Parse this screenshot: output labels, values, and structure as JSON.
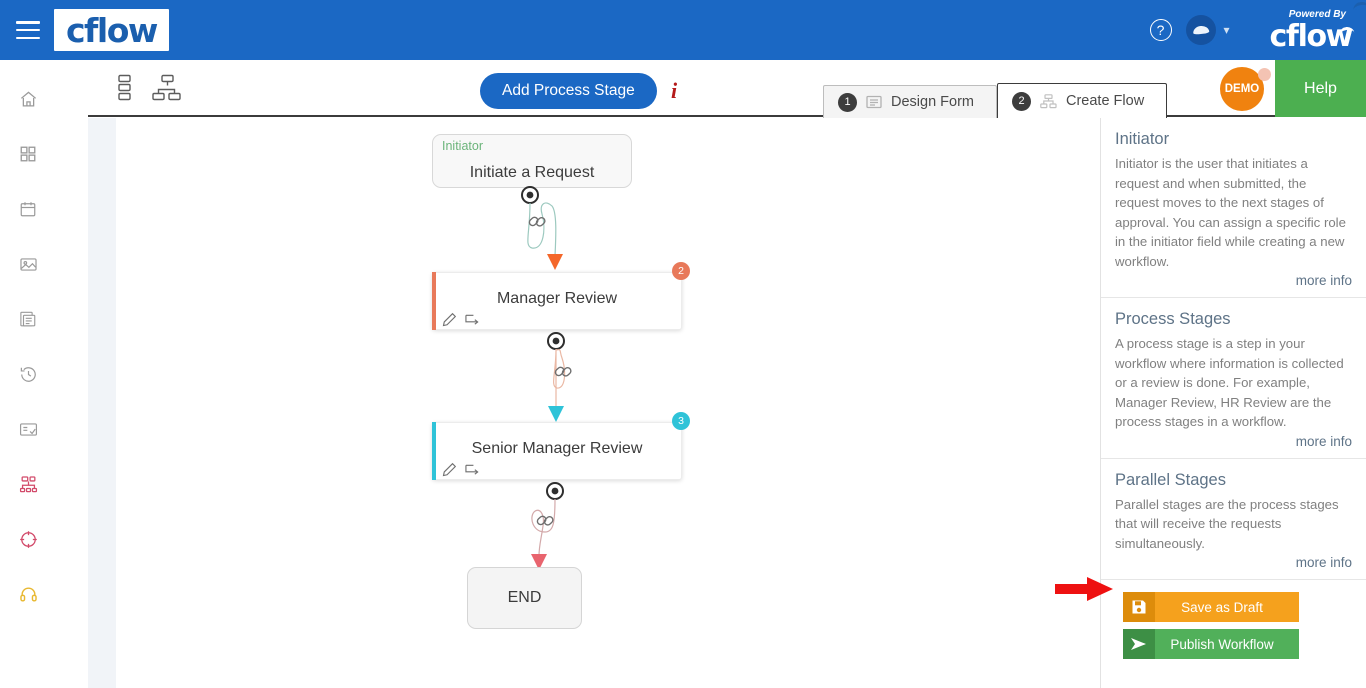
{
  "topbar": {
    "menu_icon": "hamburger-icon",
    "logo_text": "cflow",
    "help_icon": "question-circle-icon",
    "avatar_icon": "user-avatar-icon",
    "dropdown_icon": "chevron-down-icon",
    "powered_by": "Powered By",
    "powered_logo_text": "cflow"
  },
  "sidebar": {
    "items": [
      {
        "icon": "home-icon",
        "name": "sidebar-item-home"
      },
      {
        "icon": "apps-grid-icon",
        "name": "sidebar-item-apps"
      },
      {
        "icon": "calendar-icon",
        "name": "sidebar-item-calendar"
      },
      {
        "icon": "image-icon",
        "name": "sidebar-item-media"
      },
      {
        "icon": "document-icon",
        "name": "sidebar-item-documents"
      },
      {
        "icon": "history-clock-icon",
        "name": "sidebar-item-history"
      },
      {
        "icon": "report-card-icon",
        "name": "sidebar-item-reports"
      },
      {
        "icon": "org-chart-icon",
        "name": "sidebar-item-workflow"
      },
      {
        "icon": "target-icon",
        "name": "sidebar-item-goals"
      },
      {
        "icon": "headset-icon",
        "name": "sidebar-item-support"
      }
    ]
  },
  "toolbar": {
    "view_linear_icon": "linear-view-icon",
    "view_tree_icon": "tree-view-icon",
    "add_stage_label": "Add Process Stage",
    "info_label": "i",
    "tabs": [
      {
        "number": "1",
        "label": "Design Form",
        "icon": "form-icon",
        "active": false
      },
      {
        "number": "2",
        "label": "Create Flow",
        "icon": "flow-icon",
        "active": true
      }
    ],
    "demo_badge": "DEMO",
    "help_label": "Help"
  },
  "flow": {
    "initiator": {
      "tag": "Initiator",
      "title": "Initiate a Request"
    },
    "stages": [
      {
        "title": "Manager Review",
        "badge": "2",
        "color": "#e8795a",
        "badge_color": "#e8795a",
        "arrow_color": "#f4672a"
      },
      {
        "title": "Senior Manager Review",
        "badge": "3",
        "color": "#2fc3d8",
        "badge_color": "#2fc3d8",
        "arrow_color": "#2fc3d8"
      }
    ],
    "end": {
      "title": "END",
      "arrow_color": "#e8646e"
    },
    "connector_icon": "link-chain-icon",
    "anchor_icon": "connection-anchor-icon",
    "edit_icon": "pencil-edit-icon",
    "move_icon": "move-arrow-icon"
  },
  "help_panel": {
    "sections": [
      {
        "title": "Initiator",
        "body": "Initiator is the user that initiates a request and when submitted, the request moves to the next stages of approval. You can assign a specific role in the initiator field while creating a new workflow.",
        "link": "more info"
      },
      {
        "title": "Process Stages",
        "body": "A process stage is a step in your workflow where information is collected or a review is done. For example, Manager Review, HR Review are the process stages in a workflow.",
        "link": "more info"
      },
      {
        "title": "Parallel Stages",
        "body": "Parallel stages are the process stages that will receive the requests simultaneously.",
        "link": "more info"
      }
    ],
    "save_draft_label": "Save as Draft",
    "save_draft_icon": "floppy-save-icon",
    "publish_label": "Publish Workflow",
    "publish_icon": "send-arrow-icon"
  },
  "annotation": {
    "arrow_color": "#ee1111",
    "arrow_name": "red-pointer-arrow"
  },
  "colors": {
    "brand_blue": "#1b68c4",
    "orange": "#f5a11d",
    "green": "#51b05a",
    "cyan": "#2fc3d8",
    "salmon": "#e8795a"
  }
}
